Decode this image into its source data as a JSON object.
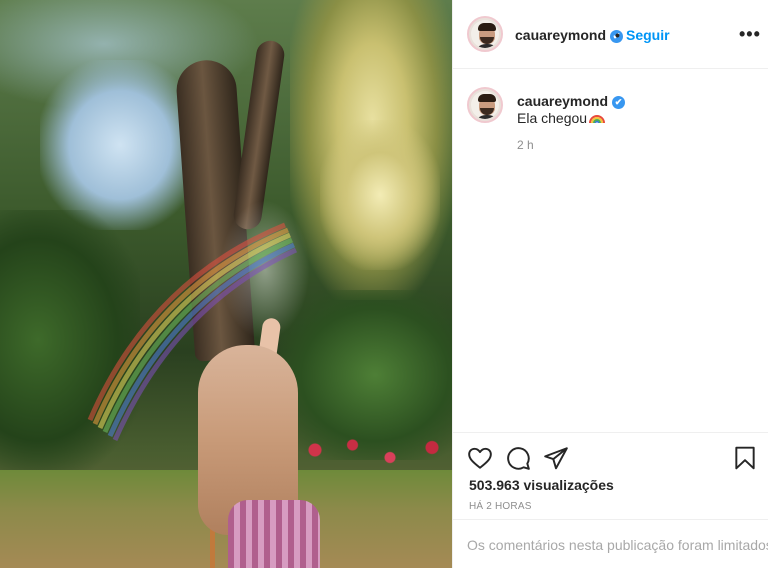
{
  "post": {
    "username": "cauareymond",
    "follow_label": "Seguir",
    "dot_separator": "•",
    "more_label": "•••",
    "verified_glyph": "✔",
    "caption_text": "Ela chegou",
    "caption_emoji": "rainbow-emoji",
    "relative_time": "2 h",
    "views_label": "503.963 visualizações",
    "date_label": "HÁ 2 HORAS",
    "comments_limited_text": "Os comentários nesta publicação foram limitados."
  },
  "icons": {
    "like": "heart-icon",
    "comment": "comment-icon",
    "share": "share-icon",
    "save": "bookmark-icon",
    "more": "more-options-icon",
    "verified": "verified-badge-icon"
  },
  "colors": {
    "accent_link": "#0095f6",
    "verified_badge": "#3897f0",
    "text_primary": "#262626",
    "text_secondary": "#8e8e8e",
    "divider": "#efefef"
  }
}
